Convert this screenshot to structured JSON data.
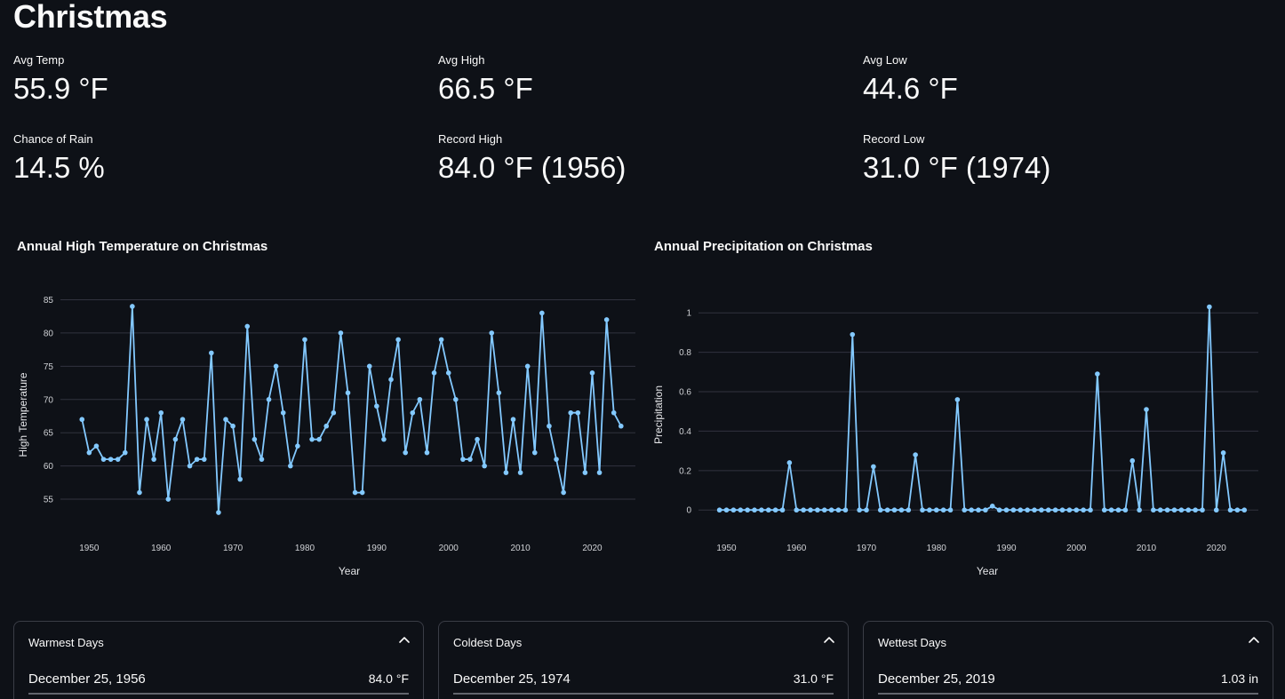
{
  "page": {
    "title": "Christmas"
  },
  "metrics": [
    {
      "label": "Avg Temp",
      "value": "55.9 °F"
    },
    {
      "label": "Avg High",
      "value": "66.5 °F"
    },
    {
      "label": "Avg Low",
      "value": "44.6 °F"
    },
    {
      "label": "Chance of Rain",
      "value": "14.5 %"
    },
    {
      "label": "Record High",
      "value": "84.0 °F (1956)"
    },
    {
      "label": "Record Low",
      "value": "31.0 °F (1974)"
    }
  ],
  "colors": {
    "background": "#0e1117",
    "series": "#83c9ff",
    "grid": "#31333f",
    "text": "#fafafa"
  },
  "chart_data": [
    {
      "type": "line",
      "title": "Annual High Temperature on Christmas",
      "xlabel": "Year",
      "ylabel": "High Temperature",
      "xlim": [
        1946,
        2026
      ],
      "ylim": [
        51,
        86
      ],
      "xticks": [
        1950,
        1960,
        1970,
        1980,
        1990,
        2000,
        2010,
        2020
      ],
      "yticks": [
        55,
        60,
        65,
        70,
        75,
        80,
        85
      ],
      "grid": true,
      "series": [
        {
          "x": [
            1949,
            1950,
            1951,
            1952,
            1953,
            1954,
            1955,
            1956,
            1957,
            1958,
            1959,
            1960,
            1961,
            1962,
            1963,
            1964,
            1965,
            1966,
            1967,
            1968,
            1969,
            1970,
            1971,
            1972,
            1973,
            1974,
            1975,
            1976,
            1977,
            1978,
            1979,
            1980,
            1981,
            1982,
            1983,
            1984,
            1985,
            1986,
            1987,
            1988,
            1989,
            1990,
            1991,
            1992,
            1993,
            1994,
            1995,
            1996,
            1997,
            1998,
            1999,
            2000,
            2001,
            2002,
            2003,
            2004,
            2005,
            2006,
            2007,
            2008,
            2009,
            2010,
            2011,
            2012,
            2013,
            2014,
            2015,
            2016,
            2017,
            2018,
            2019,
            2020,
            2021,
            2022,
            2023,
            2024
          ],
          "values": [
            67,
            62,
            63,
            61,
            61,
            61,
            62,
            84,
            56,
            67,
            61,
            68,
            55,
            64,
            67,
            60,
            61,
            61,
            77,
            53,
            67,
            66,
            58,
            81,
            64,
            61,
            70,
            75,
            68,
            60,
            63,
            79,
            64,
            64,
            66,
            68,
            80,
            71,
            56,
            56,
            75,
            69,
            64,
            73,
            79,
            62,
            68,
            70,
            62,
            74,
            79,
            74,
            70,
            61,
            61,
            64,
            60,
            80,
            71,
            59,
            67,
            59,
            75,
            62,
            83,
            66,
            61,
            56,
            68,
            68,
            59,
            74,
            59,
            82,
            68,
            66
          ]
        }
      ]
    },
    {
      "type": "line",
      "title": "Annual Precipitation on Christmas",
      "xlabel": "Year",
      "ylabel": "Precipitation",
      "xlim": [
        1946,
        2026
      ],
      "ylim": [
        -0.08,
        1.1
      ],
      "xticks": [
        1950,
        1960,
        1970,
        1980,
        1990,
        2000,
        2010,
        2020
      ],
      "yticks": [
        0,
        0.2,
        0.4,
        0.6,
        0.8,
        1
      ],
      "grid": true,
      "series": [
        {
          "x": [
            1949,
            1950,
            1951,
            1952,
            1953,
            1954,
            1955,
            1956,
            1957,
            1958,
            1959,
            1960,
            1961,
            1962,
            1963,
            1964,
            1965,
            1966,
            1967,
            1968,
            1969,
            1970,
            1971,
            1972,
            1973,
            1974,
            1975,
            1976,
            1977,
            1978,
            1979,
            1980,
            1981,
            1982,
            1983,
            1984,
            1985,
            1986,
            1987,
            1988,
            1989,
            1990,
            1991,
            1992,
            1993,
            1994,
            1995,
            1996,
            1997,
            1998,
            1999,
            2000,
            2001,
            2002,
            2003,
            2004,
            2005,
            2006,
            2007,
            2008,
            2009,
            2010,
            2011,
            2012,
            2013,
            2014,
            2015,
            2016,
            2017,
            2018,
            2019,
            2020,
            2021,
            2022,
            2023,
            2024
          ],
          "values": [
            0,
            0,
            0,
            0,
            0,
            0,
            0,
            0,
            0,
            0,
            0.24,
            0,
            0,
            0,
            0,
            0,
            0,
            0,
            0,
            0.89,
            0,
            0,
            0.22,
            0,
            0,
            0,
            0,
            0,
            0.28,
            0,
            0,
            0,
            0,
            0,
            0.56,
            0,
            0,
            0,
            0,
            0.02,
            0,
            0,
            0,
            0,
            0,
            0,
            0,
            0,
            0,
            0,
            0,
            0,
            0,
            0,
            0.69,
            0,
            0,
            0,
            0,
            0.25,
            0,
            0.51,
            0,
            0,
            0,
            0,
            0,
            0,
            0,
            0,
            1.03,
            0,
            0.29,
            0,
            0,
            0
          ]
        }
      ]
    }
  ],
  "expanders": [
    {
      "header": "Warmest Days",
      "date": "December 25, 1956",
      "value": "84.0 °F"
    },
    {
      "header": "Coldest Days",
      "date": "December 25, 1974",
      "value": "31.0 °F"
    },
    {
      "header": "Wettest Days",
      "date": "December 25, 2019",
      "value": "1.03 in"
    }
  ]
}
